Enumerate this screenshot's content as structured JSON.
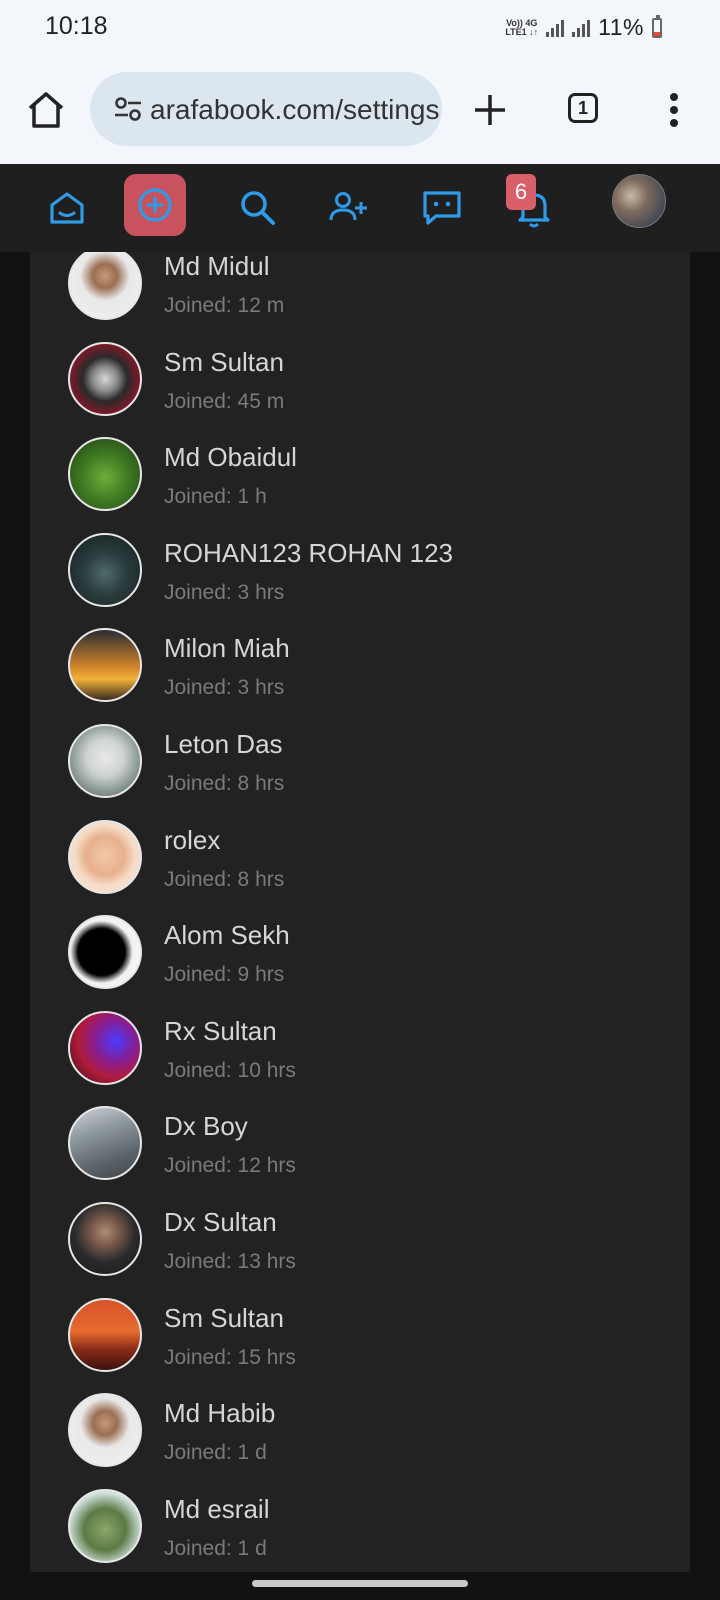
{
  "status_bar": {
    "time": "10:18",
    "net_top": "Vo)) 4G",
    "net_bottom": "LTE1 ↓↑",
    "battery": "11%"
  },
  "browser": {
    "url": "arafabook.com/settings",
    "tab_count": "1"
  },
  "nav": {
    "notification_count": "6",
    "accent_color": "#2f9be8",
    "create_bg_color": "#c8535f"
  },
  "users": [
    {
      "name": "Md Midul",
      "joined": "Joined: 12 m",
      "avatar": "man-portrait"
    },
    {
      "name": "Sm Sultan",
      "joined": "Joined: 45 m",
      "avatar": "dark-mask"
    },
    {
      "name": "Md Obaidul",
      "joined": "Joined: 1 h",
      "avatar": "green-plants"
    },
    {
      "name": "ROHAN123 ROHAN 123",
      "joined": "Joined: 3 hrs",
      "avatar": "motorbike"
    },
    {
      "name": "Milon Miah",
      "joined": "Joined: 3 hrs",
      "avatar": "sunset-silhouette"
    },
    {
      "name": "Leton Das",
      "joined": "Joined: 8 hrs",
      "avatar": "marshmello"
    },
    {
      "name": "rolex",
      "joined": "Joined: 8 hrs",
      "avatar": "memoji-glasses"
    },
    {
      "name": "Alom Sekh",
      "joined": "Joined: 9 hrs",
      "avatar": "black-silhouette"
    },
    {
      "name": "Rx Sultan",
      "joined": "Joined: 10 hrs",
      "avatar": "red-blue-neon"
    },
    {
      "name": "Dx Boy",
      "joined": "Joined: 12 hrs",
      "avatar": "rail-tracks"
    },
    {
      "name": "Dx Sultan",
      "joined": "Joined: 13 hrs",
      "avatar": "man-dark"
    },
    {
      "name": "Sm Sultan",
      "joined": "Joined: 15 hrs",
      "avatar": "orange-castle"
    },
    {
      "name": "Md Habib",
      "joined": "Joined: 1 d",
      "avatar": "man-portrait"
    },
    {
      "name": "Md esrail",
      "joined": "Joined: 1 d",
      "avatar": "outdoor-tree"
    }
  ]
}
